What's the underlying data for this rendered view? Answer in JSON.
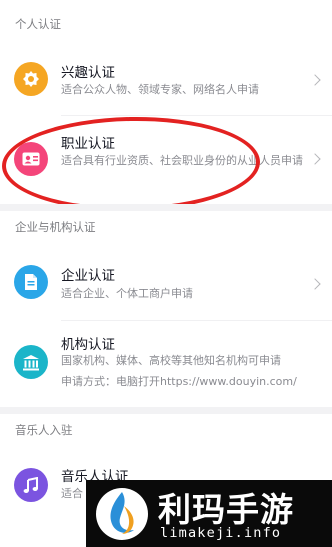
{
  "sections": {
    "personal": "个人认证",
    "enterprise": "企业与机构认证",
    "music": "音乐人入驻"
  },
  "items": {
    "interest": {
      "title": "兴趣认证",
      "desc": "适合公众人物、领域专家、网络名人申请",
      "icon": "badge-icon",
      "color": "#f5a623"
    },
    "career": {
      "title": "职业认证",
      "desc": "适合具有行业资质、社会职业身份的从业人员申请",
      "icon": "id-card-icon",
      "color": "#f4457a"
    },
    "enterprise": {
      "title": "企业认证",
      "desc": "适合企业、个体工商户申请",
      "icon": "document-icon",
      "color": "#2aa6e8"
    },
    "institution": {
      "title": "机构认证",
      "desc": "国家机构、媒体、高校等其他知名机构可申请",
      "desc2": "申请方式：电脑打开https://www.douyin.com/",
      "icon": "bank-icon",
      "color": "#1bb5c9"
    },
    "musician": {
      "title": "音乐人认证",
      "desc": "适合",
      "icon": "music-note-icon",
      "color": "#7b54e0"
    }
  },
  "watermark": {
    "title": "利玛手游",
    "url": "limakeji.info"
  }
}
